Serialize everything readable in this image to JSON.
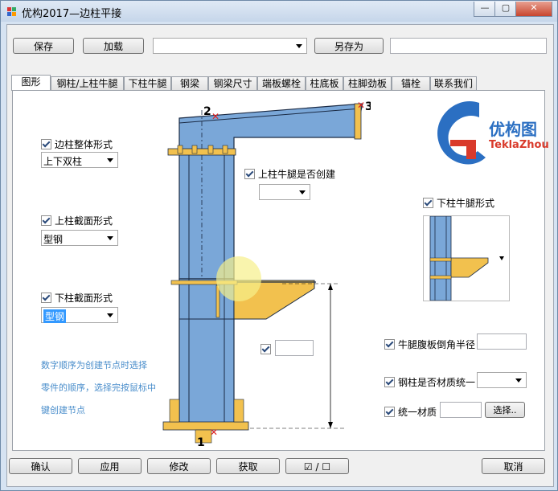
{
  "window": {
    "title": "优构2017—边柱平接"
  },
  "toolbar": {
    "save_label": "保存",
    "load_label": "加载",
    "preset_value": "",
    "save_as_label": "另存为",
    "save_as_name": ""
  },
  "tabs": [
    {
      "label": "图形"
    },
    {
      "label": "钢柱/上柱牛腿"
    },
    {
      "label": "下柱牛腿"
    },
    {
      "label": "钢梁"
    },
    {
      "label": "钢梁尺寸"
    },
    {
      "label": "端板螺栓"
    },
    {
      "label": "柱底板"
    },
    {
      "label": "柱脚劲板"
    },
    {
      "label": "锚栓"
    },
    {
      "label": "联系我们"
    }
  ],
  "options": {
    "overall_form": {
      "label": "边柱整体形式",
      "checked": true,
      "value": "上下双柱"
    },
    "upper_section": {
      "label": "上柱截面形式",
      "checked": true,
      "value": "型钢"
    },
    "lower_section": {
      "label": "下柱截面形式",
      "checked": true,
      "value": "型钢"
    },
    "upper_bracket_create": {
      "label": "上柱牛腿是否创建",
      "checked": true,
      "value": ""
    },
    "lower_bracket_form": {
      "label": "下柱牛腿形式",
      "checked": true
    },
    "web_chamfer": {
      "label": "牛腿腹板倒角半径",
      "checked": true,
      "value": ""
    },
    "unified_material": {
      "label": "钢柱是否材质统一",
      "checked": true,
      "value": ""
    },
    "material": {
      "label": "统一材质",
      "checked": true,
      "value": "",
      "select_label": "选择.."
    },
    "unlabeled": {
      "checked": true,
      "value": ""
    }
  },
  "hint": {
    "line1": "数字顺序为创建节点时选择",
    "line2": "零件的顺序，选择完按鼠标中",
    "line3": "键创建节点"
  },
  "diagram": {
    "point1": "1",
    "point2": "2",
    "point3": "3"
  },
  "logo": {
    "cn": "优构图",
    "en": "TeklaZhou"
  },
  "bottom": {
    "ok": "确认",
    "apply": "应用",
    "modify": "修改",
    "get": "获取",
    "toggle": "☑ / ☐",
    "cancel": "取消"
  },
  "colors": {
    "steel": "#7aa7d8",
    "plate": "#f2c14e",
    "accent": "#4a8ecb"
  }
}
